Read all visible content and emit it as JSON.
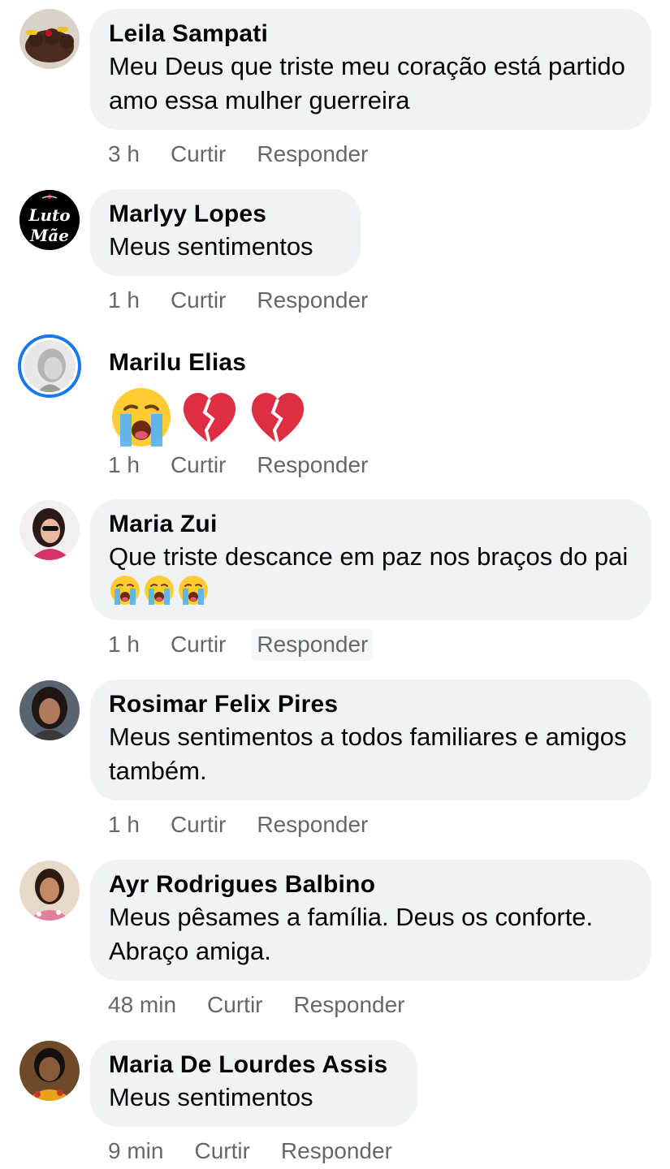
{
  "comments": [
    {
      "name": "Leila Sampati",
      "text": "Meu Deus que triste meu coração  está partido amo essa mulher guerreira",
      "time": "3 h",
      "like": "Curtir",
      "reply": "Responder"
    },
    {
      "name": "Marlyy Lopes",
      "text": "Meus sentimentos",
      "time": "1 h",
      "like": "Curtir",
      "reply": "Responder",
      "avatar_text": [
        "Luto",
        "Mãe"
      ]
    },
    {
      "name": "Marilu Elias",
      "text": "",
      "time": "1 h",
      "like": "Curtir",
      "reply": "Responder",
      "emojis": [
        "crying-face-emoji",
        "broken-heart-emoji",
        "broken-heart-emoji"
      ]
    },
    {
      "name": "Maria Zui",
      "text": "Que triste  descance em paz nos braços do pai",
      "time": "1 h",
      "like": "Curtir",
      "reply": "Responder",
      "emojis": [
        "crying-face-emoji",
        "crying-face-emoji",
        "crying-face-emoji"
      ]
    },
    {
      "name": "Rosimar Felix Pires",
      "text": "Meus sentimentos a todos familiares e amigos também.",
      "time": "1 h",
      "like": "Curtir",
      "reply": "Responder"
    },
    {
      "name": "Ayr Rodrigues Balbino",
      "text": "Meus pêsames a família. Deus os conforte. Abraço amiga.",
      "time": "48 min",
      "like": "Curtir",
      "reply": "Responder"
    },
    {
      "name": "Maria De Lourdes Assis",
      "text": "Meus sentimentos",
      "time": "9 min",
      "like": "Curtir",
      "reply": "Responder"
    }
  ],
  "colors": {
    "bubble": "#f0f2f5",
    "meta": "#65676b",
    "story_ring": "#1877f2",
    "broken_heart": "#dd2e44"
  }
}
